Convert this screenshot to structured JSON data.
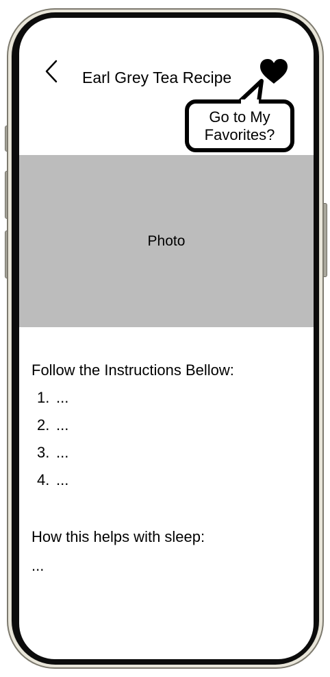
{
  "header": {
    "back_icon": "chevron-left-icon",
    "title": "Earl Grey Tea Recipe",
    "favorite_icon": "heart-icon"
  },
  "favorites_prompt": {
    "line1": "Go to My",
    "line2": "Favorites?"
  },
  "photo": {
    "label": "Photo",
    "placeholder_color": "#bcbcbc"
  },
  "instructions": {
    "heading": "Follow the Instructions Bellow:",
    "steps": [
      {
        "number": "1.",
        "text": "..."
      },
      {
        "number": "2.",
        "text": "..."
      },
      {
        "number": "3.",
        "text": "..."
      },
      {
        "number": "4.",
        "text": "..."
      }
    ]
  },
  "sleep": {
    "heading": "How this helps with sleep:",
    "text": "..."
  }
}
